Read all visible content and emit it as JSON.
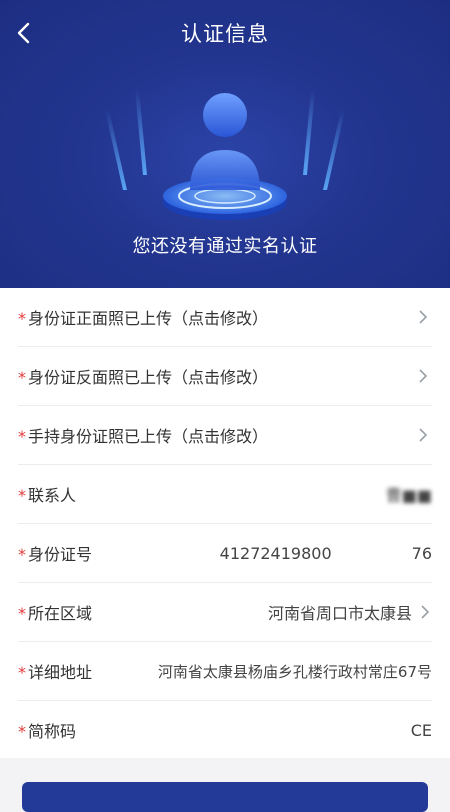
{
  "header": {
    "title": "认证信息",
    "status": "您还没有通过实名认证"
  },
  "rows": [
    {
      "label": "身份证正面照已上传（点击修改）"
    },
    {
      "label": "身份证反面照已上传（点击修改）"
    },
    {
      "label": "手持身份证照已上传（点击修改）"
    },
    {
      "label": "联系人",
      "value": "曹■■"
    },
    {
      "label": "身份证号",
      "value": "41272419800     76"
    },
    {
      "label": "所在区域",
      "value": "河南省周口市太康县"
    },
    {
      "label": "详细地址",
      "value": "河南省太康县杨庙乡孔楼行政村常庄67号"
    },
    {
      "label": "简称码",
      "value": "CE"
    }
  ],
  "required_mark": "*",
  "colors": {
    "header": "#22358f",
    "required": "#e23a3a",
    "button": "#243a98"
  }
}
